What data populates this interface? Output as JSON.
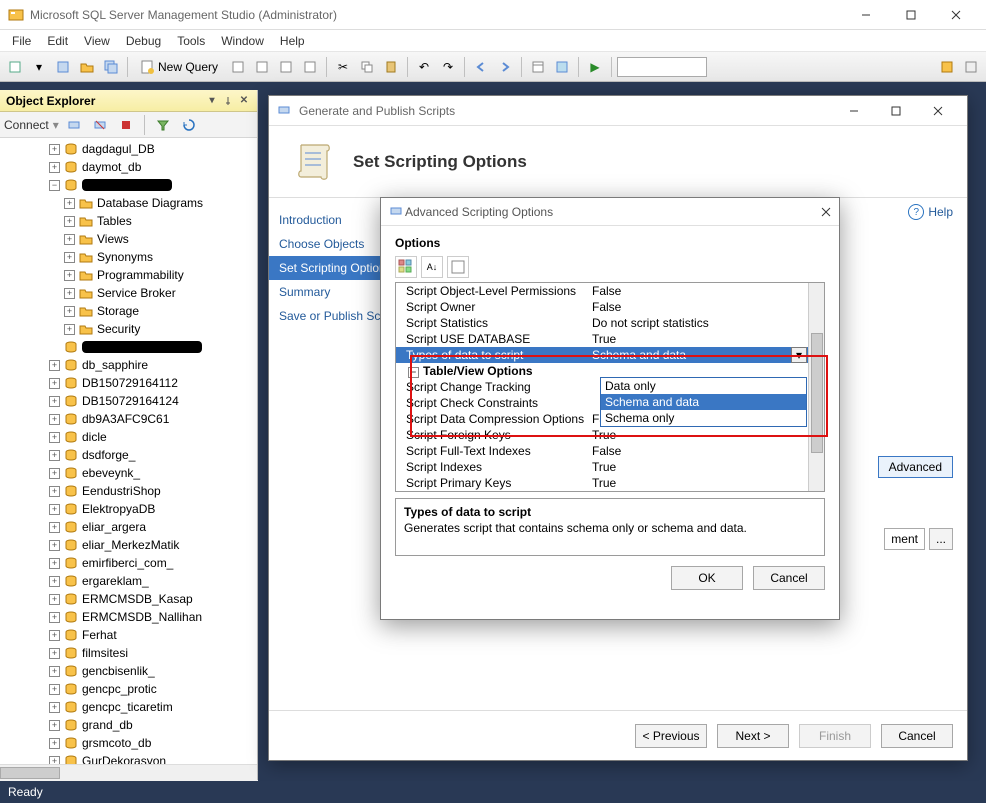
{
  "app": {
    "title": "Microsoft SQL Server Management Studio (Administrator)"
  },
  "menubar": [
    "File",
    "Edit",
    "View",
    "Debug",
    "Tools",
    "Window",
    "Help"
  ],
  "toolbar": {
    "new_query": "New Query"
  },
  "object_explorer": {
    "title": "Object Explorer",
    "connect_label": "Connect",
    "tree_top": [
      "dagdagul_DB",
      "daymot_db"
    ],
    "expanded_children": [
      "Database Diagrams",
      "Tables",
      "Views",
      "Synonyms",
      "Programmability",
      "Service Broker",
      "Storage",
      "Security"
    ],
    "tree_bottom": [
      "db_sapphire",
      "DB150729164112",
      "DB150729164124",
      "db9A3AFC9C61",
      "dicle",
      "dsdforge_",
      "ebeveynk_",
      "EendustriShop",
      "ElektropyaDB",
      "eliar_argera",
      "eliar_MerkezMatik",
      "emirfiberci_com_",
      "ergareklam_",
      "ERMCMSDB_Kasap",
      "ERMCMSDB_Nallihan",
      "Ferhat",
      "filmsitesi",
      "gencbisenlik_",
      "gencpc_protic",
      "gencpc_ticaretim",
      "grand_db",
      "grsmcoto_db",
      "GurDekorasyon"
    ]
  },
  "wizard": {
    "window_title": "Generate and Publish Scripts",
    "heading": "Set Scripting Options",
    "help": "Help",
    "steps": [
      "Introduction",
      "Choose Objects",
      "Set Scripting Options",
      "Summary",
      "Save or Publish Scripts"
    ],
    "selected_step": 2,
    "advanced_btn": "Advanced",
    "save_fragment": "ment",
    "browse": "...",
    "buttons": {
      "prev": "< Previous",
      "next": "Next >",
      "finish": "Finish",
      "cancel": "Cancel"
    }
  },
  "advanced": {
    "window_title": "Advanced Scripting Options",
    "section": "Options",
    "rows": [
      {
        "label": "Script Object-Level Permissions",
        "value": "False"
      },
      {
        "label": "Script Owner",
        "value": "False"
      },
      {
        "label": "Script Statistics",
        "value": "Do not script statistics"
      },
      {
        "label": "Script USE DATABASE",
        "value": "True"
      },
      {
        "label": "Types of data to script",
        "value": "Schema and data",
        "selected": true
      },
      {
        "label": "Table/View Options",
        "value": "",
        "category": true
      },
      {
        "label": "Script Change Tracking",
        "value": ""
      },
      {
        "label": "Script Check Constraints",
        "value": ""
      },
      {
        "label": "Script Data Compression Options",
        "value": "False"
      },
      {
        "label": "Script Foreign Keys",
        "value": "True"
      },
      {
        "label": "Script Full-Text Indexes",
        "value": "False"
      },
      {
        "label": "Script Indexes",
        "value": "True"
      },
      {
        "label": "Script Primary Keys",
        "value": "True"
      }
    ],
    "dropdown": {
      "options": [
        "Data only",
        "Schema and data",
        "Schema only"
      ],
      "selected": 1
    },
    "desc_title": "Types of data to script",
    "desc_text": "Generates script that contains schema only or schema and data.",
    "ok": "OK",
    "cancel": "Cancel"
  },
  "status": "Ready"
}
